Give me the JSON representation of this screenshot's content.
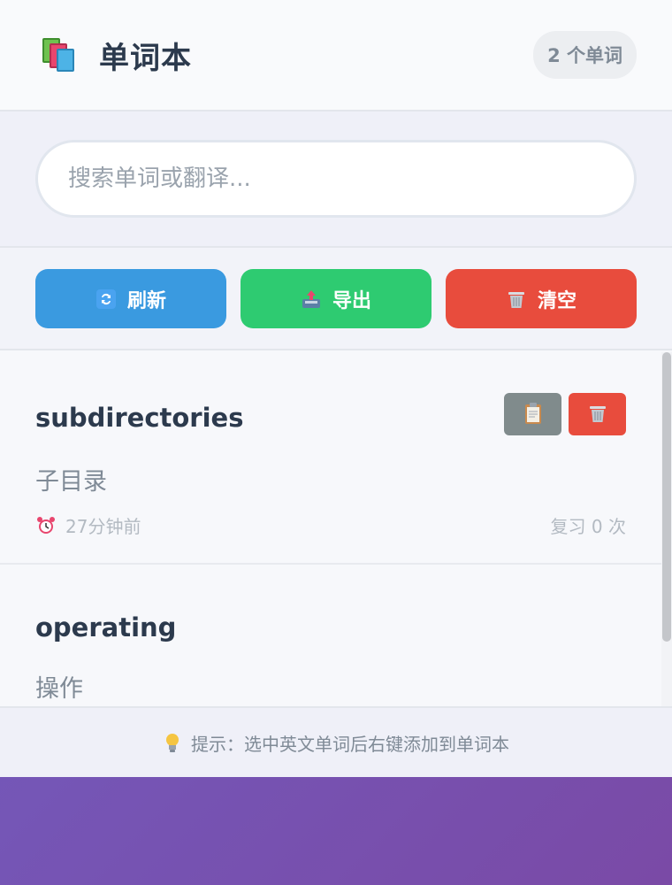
{
  "header": {
    "title": "单词本",
    "word_count": "2 个单词",
    "icon": "books-icon"
  },
  "search": {
    "placeholder": "搜索单词或翻译...",
    "value": ""
  },
  "actions": {
    "refresh_label": "刷新",
    "export_label": "导出",
    "clear_label": "清空",
    "colors": {
      "refresh": "#3a9ae0",
      "export": "#2ecb71",
      "clear": "#e84c3d"
    }
  },
  "words": [
    {
      "english": "subdirectories",
      "chinese": "子目录",
      "time": "27分钟前",
      "review": "复习 0 次"
    },
    {
      "english": "operating",
      "chinese": "操作"
    }
  ],
  "footer": {
    "tip": "提示：选中英文单词后右键添加到单词本"
  }
}
